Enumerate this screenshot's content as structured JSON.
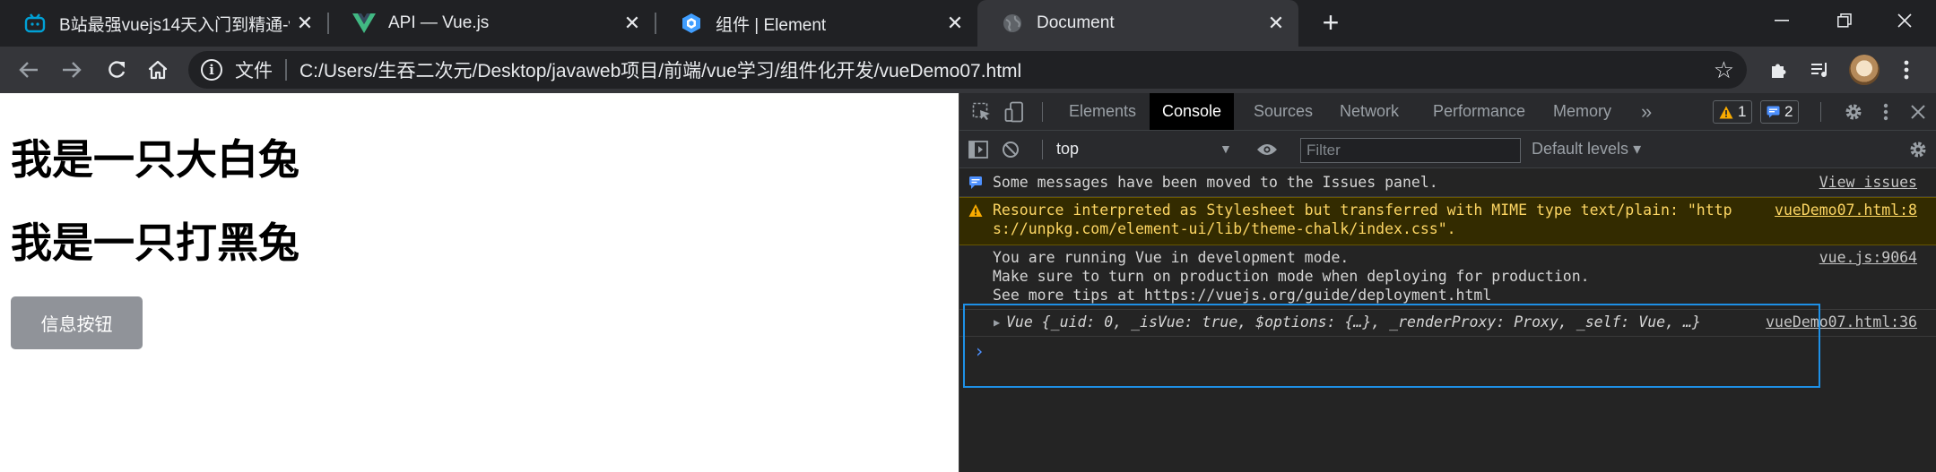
{
  "browser": {
    "tabs": [
      {
        "title": "B站最强vuejs14天入门到精通-vu",
        "icon": "bilibili-icon"
      },
      {
        "title": "API — Vue.js",
        "icon": "vue-icon"
      },
      {
        "title": "组件 | Element",
        "icon": "element-icon"
      },
      {
        "title": "Document",
        "icon": "globe-icon",
        "active": true
      }
    ],
    "address": {
      "scheme_label": "文件",
      "url": "C:/Users/生吞二次元/Desktop/javaweb项目/前端/vue学习/组件化开发/vueDemo07.html"
    }
  },
  "page": {
    "heading1": "我是一只大白兔",
    "heading2": "我是一只打黑兔",
    "button_label": "信息按钮"
  },
  "devtools": {
    "tabs": [
      "Elements",
      "Console",
      "Sources",
      "Network",
      "Performance",
      "Memory"
    ],
    "active_tab": "Console",
    "more_tabs": "»",
    "warning_count": "1",
    "issue_count": "2",
    "context": "top",
    "filter_placeholder": "Filter",
    "levels_label": "Default levels",
    "messages": [
      {
        "type": "info",
        "text": "Some messages have been moved to the Issues panel.",
        "source": "View issues"
      },
      {
        "type": "warning",
        "text": "Resource interpreted as Stylesheet but transferred with MIME type text/plain: \"http\ns://unpkg.com/element-ui/lib/theme-chalk/index.css\".",
        "source": "vueDemo07.html:8"
      },
      {
        "type": "log",
        "text": "You are running Vue in development mode.\nMake sure to turn on production mode when deploying for production.\nSee more tips at https://vuejs.org/guide/deployment.html",
        "source": "vue.js:9064"
      },
      {
        "type": "object",
        "text": "Vue {_uid: 0, _isVue: true, $options: {…}, _renderProxy: Proxy, _self: Vue, …}",
        "source": "vueDemo07.html:36"
      }
    ],
    "prompt": "›"
  },
  "colors": {
    "accent": "#1e90e6",
    "warning_bg": "#332b00",
    "warning_text": "#fdd663",
    "button_gray": "#909399"
  }
}
